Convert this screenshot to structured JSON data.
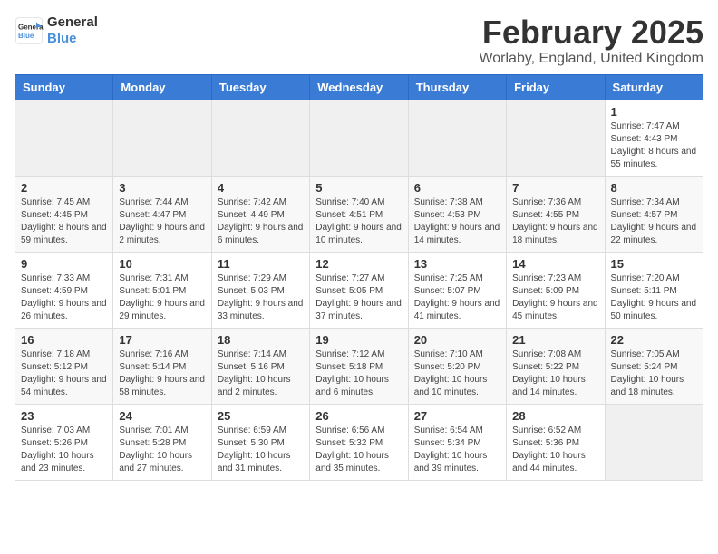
{
  "header": {
    "logo_line1": "General",
    "logo_line2": "Blue",
    "title": "February 2025",
    "subtitle": "Worlaby, England, United Kingdom"
  },
  "weekdays": [
    "Sunday",
    "Monday",
    "Tuesday",
    "Wednesday",
    "Thursday",
    "Friday",
    "Saturday"
  ],
  "weeks": [
    [
      {
        "day": "",
        "info": ""
      },
      {
        "day": "",
        "info": ""
      },
      {
        "day": "",
        "info": ""
      },
      {
        "day": "",
        "info": ""
      },
      {
        "day": "",
        "info": ""
      },
      {
        "day": "",
        "info": ""
      },
      {
        "day": "1",
        "info": "Sunrise: 7:47 AM\nSunset: 4:43 PM\nDaylight: 8 hours and 55 minutes."
      }
    ],
    [
      {
        "day": "2",
        "info": "Sunrise: 7:45 AM\nSunset: 4:45 PM\nDaylight: 8 hours and 59 minutes."
      },
      {
        "day": "3",
        "info": "Sunrise: 7:44 AM\nSunset: 4:47 PM\nDaylight: 9 hours and 2 minutes."
      },
      {
        "day": "4",
        "info": "Sunrise: 7:42 AM\nSunset: 4:49 PM\nDaylight: 9 hours and 6 minutes."
      },
      {
        "day": "5",
        "info": "Sunrise: 7:40 AM\nSunset: 4:51 PM\nDaylight: 9 hours and 10 minutes."
      },
      {
        "day": "6",
        "info": "Sunrise: 7:38 AM\nSunset: 4:53 PM\nDaylight: 9 hours and 14 minutes."
      },
      {
        "day": "7",
        "info": "Sunrise: 7:36 AM\nSunset: 4:55 PM\nDaylight: 9 hours and 18 minutes."
      },
      {
        "day": "8",
        "info": "Sunrise: 7:34 AM\nSunset: 4:57 PM\nDaylight: 9 hours and 22 minutes."
      }
    ],
    [
      {
        "day": "9",
        "info": "Sunrise: 7:33 AM\nSunset: 4:59 PM\nDaylight: 9 hours and 26 minutes."
      },
      {
        "day": "10",
        "info": "Sunrise: 7:31 AM\nSunset: 5:01 PM\nDaylight: 9 hours and 29 minutes."
      },
      {
        "day": "11",
        "info": "Sunrise: 7:29 AM\nSunset: 5:03 PM\nDaylight: 9 hours and 33 minutes."
      },
      {
        "day": "12",
        "info": "Sunrise: 7:27 AM\nSunset: 5:05 PM\nDaylight: 9 hours and 37 minutes."
      },
      {
        "day": "13",
        "info": "Sunrise: 7:25 AM\nSunset: 5:07 PM\nDaylight: 9 hours and 41 minutes."
      },
      {
        "day": "14",
        "info": "Sunrise: 7:23 AM\nSunset: 5:09 PM\nDaylight: 9 hours and 45 minutes."
      },
      {
        "day": "15",
        "info": "Sunrise: 7:20 AM\nSunset: 5:11 PM\nDaylight: 9 hours and 50 minutes."
      }
    ],
    [
      {
        "day": "16",
        "info": "Sunrise: 7:18 AM\nSunset: 5:12 PM\nDaylight: 9 hours and 54 minutes."
      },
      {
        "day": "17",
        "info": "Sunrise: 7:16 AM\nSunset: 5:14 PM\nDaylight: 9 hours and 58 minutes."
      },
      {
        "day": "18",
        "info": "Sunrise: 7:14 AM\nSunset: 5:16 PM\nDaylight: 10 hours and 2 minutes."
      },
      {
        "day": "19",
        "info": "Sunrise: 7:12 AM\nSunset: 5:18 PM\nDaylight: 10 hours and 6 minutes."
      },
      {
        "day": "20",
        "info": "Sunrise: 7:10 AM\nSunset: 5:20 PM\nDaylight: 10 hours and 10 minutes."
      },
      {
        "day": "21",
        "info": "Sunrise: 7:08 AM\nSunset: 5:22 PM\nDaylight: 10 hours and 14 minutes."
      },
      {
        "day": "22",
        "info": "Sunrise: 7:05 AM\nSunset: 5:24 PM\nDaylight: 10 hours and 18 minutes."
      }
    ],
    [
      {
        "day": "23",
        "info": "Sunrise: 7:03 AM\nSunset: 5:26 PM\nDaylight: 10 hours and 23 minutes."
      },
      {
        "day": "24",
        "info": "Sunrise: 7:01 AM\nSunset: 5:28 PM\nDaylight: 10 hours and 27 minutes."
      },
      {
        "day": "25",
        "info": "Sunrise: 6:59 AM\nSunset: 5:30 PM\nDaylight: 10 hours and 31 minutes."
      },
      {
        "day": "26",
        "info": "Sunrise: 6:56 AM\nSunset: 5:32 PM\nDaylight: 10 hours and 35 minutes."
      },
      {
        "day": "27",
        "info": "Sunrise: 6:54 AM\nSunset: 5:34 PM\nDaylight: 10 hours and 39 minutes."
      },
      {
        "day": "28",
        "info": "Sunrise: 6:52 AM\nSunset: 5:36 PM\nDaylight: 10 hours and 44 minutes."
      },
      {
        "day": "",
        "info": ""
      }
    ]
  ]
}
